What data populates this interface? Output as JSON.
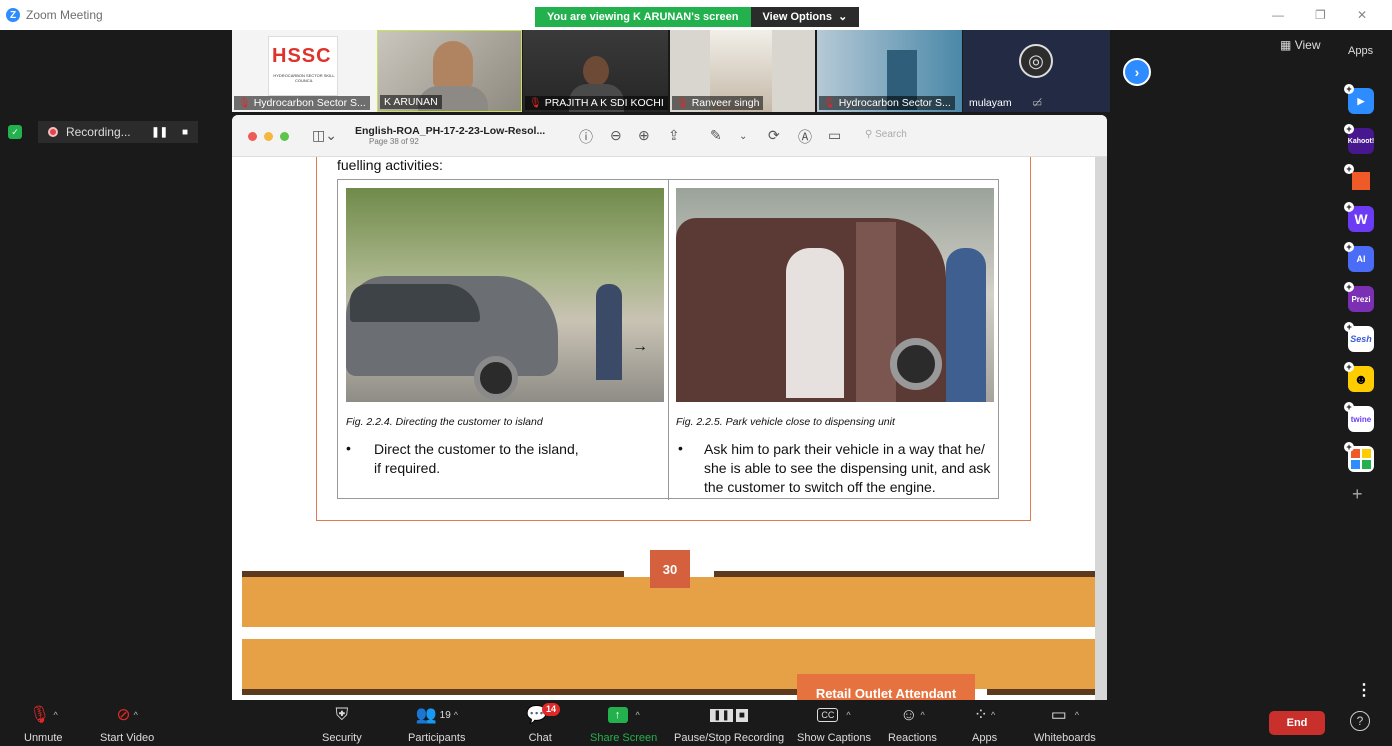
{
  "window": {
    "app_title": "Zoom Meeting",
    "viewing_banner": "You are viewing K ARUNAN's screen",
    "view_options": "View Options"
  },
  "participants_strip": [
    {
      "name": "Hydrocarbon Sector S...",
      "muted": true
    },
    {
      "name": "K ARUNAN",
      "muted": false
    },
    {
      "name": "PRAJITH A K SDI KOCHI",
      "muted": true
    },
    {
      "name": "Ranveer singh",
      "muted": true
    },
    {
      "name": "Hydrocarbon Sector S...",
      "muted": true
    },
    {
      "name": "mulayam",
      "muted": false
    }
  ],
  "logo": {
    "big": "HSSC",
    "small": "HYDROCARBON SECTOR SKILL COUNCIL"
  },
  "recording": {
    "label": "Recording..."
  },
  "right_panel": {
    "view_label": "View",
    "apps_title": "Apps",
    "apps": [
      {
        "name": "Pointer",
        "color": "#2d8cff"
      },
      {
        "name": "Kahoot!",
        "color": "#46178f"
      },
      {
        "name": "Miro",
        "color": "#f05a28"
      },
      {
        "name": "Wooclap",
        "color": "#6c3cf5"
      },
      {
        "name": "Quiz AI",
        "color": "#4a6cf7"
      },
      {
        "name": "Prezi",
        "color": "#7b2fb3"
      },
      {
        "name": "Sesh",
        "color": "#ffffff"
      },
      {
        "name": "Emoji",
        "color": "#ffcc00"
      },
      {
        "name": "twine",
        "color": "#ffffff"
      },
      {
        "name": "Blocks",
        "color": "#222222"
      }
    ]
  },
  "document": {
    "title": "English-ROA_PH-17-2-23-Low-Resol...",
    "page_info": "Page 38 of 92",
    "search_placeholder": "Search",
    "heading_fragment": "fuelling activities:",
    "left_caption": "Fig. 2.2.4. Directing the customer to island",
    "left_bullet_line1": "Direct the customer to the island,",
    "left_bullet_line2": "if required.",
    "right_caption": "Fig. 2.2.5. Park vehicle close to dispensing unit",
    "right_bullet_line1": "Ask him to park their vehicle in a way that he/",
    "right_bullet_line2": "she is able to see the dispensing unit, and ask",
    "right_bullet_line3": "the customer to switch off the engine.",
    "page_number": "30",
    "next_page_label": "Retail Outlet Attendant"
  },
  "toolbar": {
    "unmute": "Unmute",
    "start_video": "Start Video",
    "security": "Security",
    "participants": "Participants",
    "participants_count": "19",
    "chat": "Chat",
    "chat_badge": "14",
    "share_screen": "Share Screen",
    "pause_stop": "Pause/Stop Recording",
    "show_captions": "Show Captions",
    "captions_glyph": "CC",
    "reactions": "Reactions",
    "apps": "Apps",
    "whiteboards": "Whiteboards",
    "end": "End"
  }
}
